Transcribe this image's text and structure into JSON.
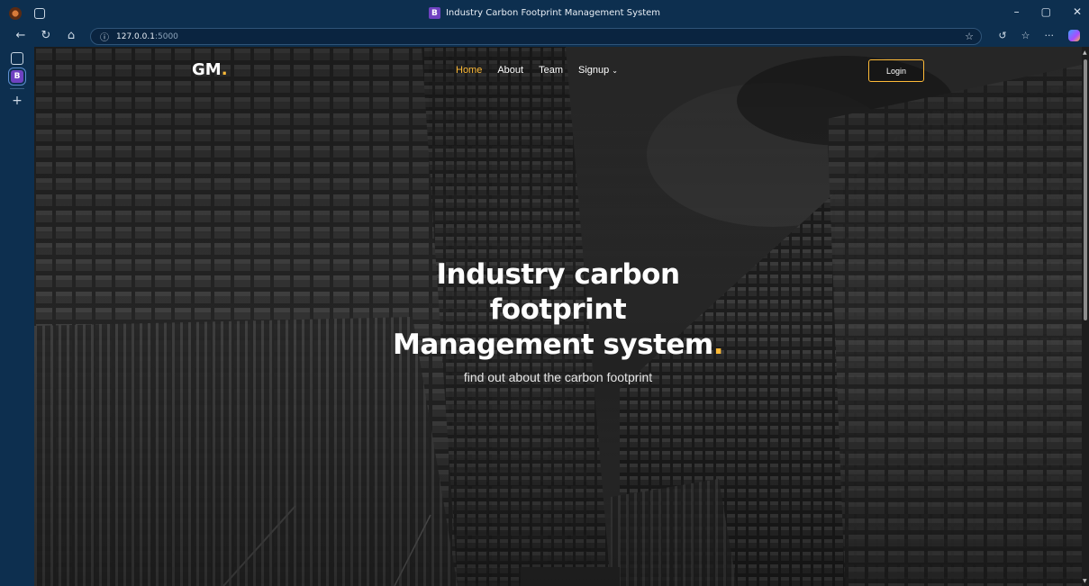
{
  "browser": {
    "window_title": "Industry Carbon Footprint Management System",
    "tab_favicon_letter": "B",
    "address": {
      "host": "127.0.0.1",
      "port": ":5000"
    }
  },
  "site": {
    "logo": {
      "text": "GM",
      "dot": "."
    },
    "nav": [
      {
        "label": "Home",
        "active": true
      },
      {
        "label": "About",
        "active": false
      },
      {
        "label": "Team",
        "active": false
      },
      {
        "label": "Signup",
        "active": false,
        "dropdown": true
      }
    ],
    "login_label": "Login",
    "hero": {
      "title_line1": "Industry carbon",
      "title_line2": "footprint",
      "title_line3": "Management system",
      "title_dot": ".",
      "subtitle": "find out about the carbon footprint"
    },
    "accent_color": "#ffbb38"
  }
}
